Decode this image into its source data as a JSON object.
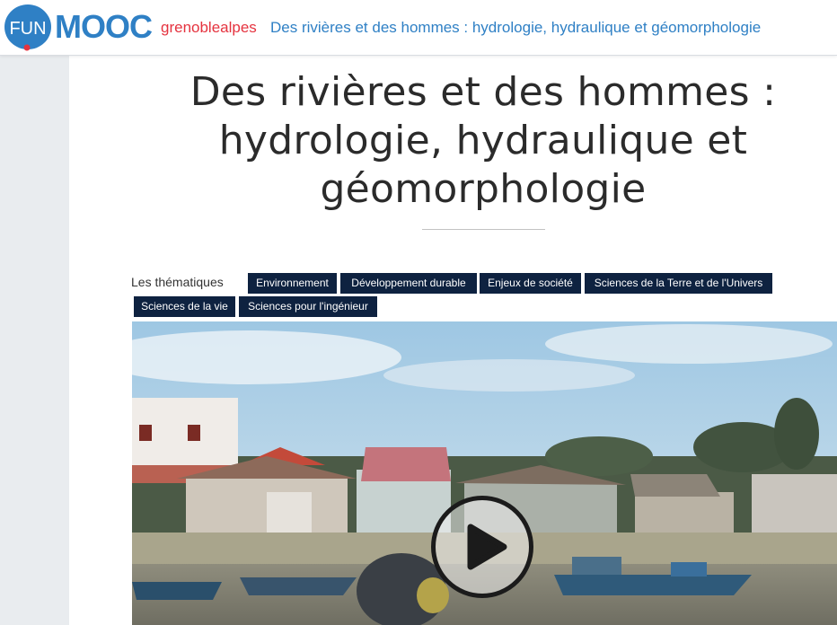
{
  "header": {
    "logo": {
      "fun": "FUN",
      "mooc": "MOOC"
    },
    "org_link": "grenoblealpes",
    "course_link": "Des rivières et des hommes : hydrologie, hydraulique et géomorphologie"
  },
  "course": {
    "title_lines": [
      "Des rivières et des hommes :",
      "hydrologie, hydraulique et",
      "géomorphologie"
    ]
  },
  "themes": {
    "label": "Les thématiques",
    "tags": [
      "Environnement",
      "Développement durable",
      "Enjeux de société",
      "Sciences de la Terre et de l'Univers",
      "Sciences de la vie",
      "Sciences pour l'ingénieur"
    ]
  },
  "video": {
    "play_icon": "play-icon"
  },
  "colors": {
    "brand_blue": "#2f80c5",
    "brand_red": "#e5333f",
    "tag_bg": "#0e2240",
    "gutter": "#e9ecef"
  }
}
